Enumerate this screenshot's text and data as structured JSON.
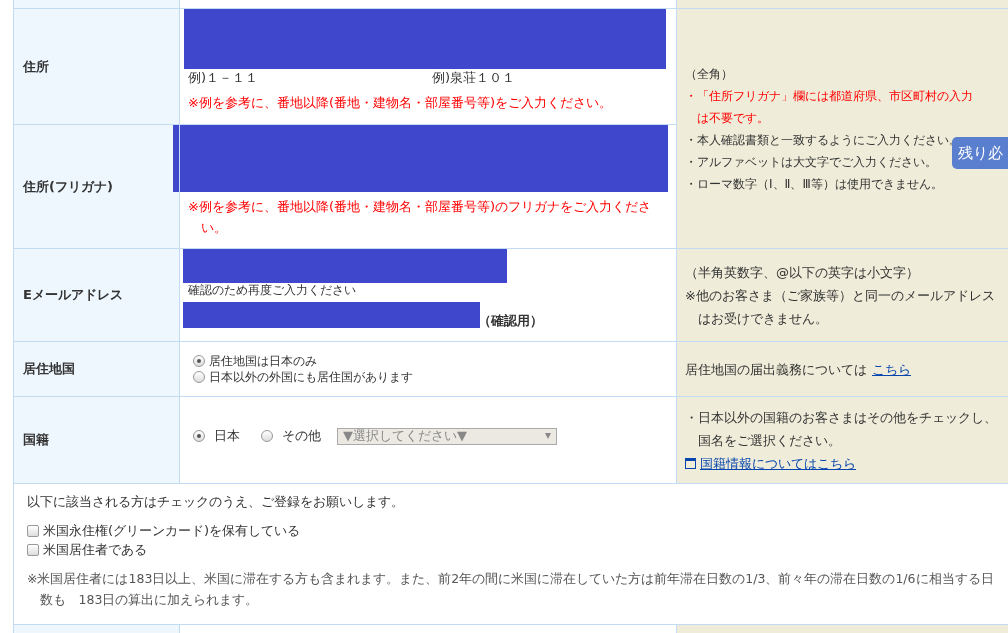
{
  "address": {
    "label": "住所",
    "examples": [
      "例)１－１１",
      "例)泉荘１０１"
    ],
    "warning": "※例を参考に、番地以降(番地・建物名・部屋番号等)をご入力ください。"
  },
  "address_kana": {
    "label": "住所(フリガナ)",
    "warning": "※例を参考に、番地以降(番地・建物名・部屋番号等)のフリガナをご入力ください。"
  },
  "address_notes": [
    {
      "text": "（全角）",
      "emphasis": false
    },
    {
      "text": "・「住所フリガナ」欄には都道府県、市区町村の入力は不要です。",
      "emphasis": true
    },
    {
      "text": "・本人確認書類と一致するようにご入力ください。",
      "emphasis": false
    },
    {
      "text": "・アルファベットは大文字でご入力ください。",
      "emphasis": false
    },
    {
      "text": "・ローマ数字（Ⅰ、Ⅱ、Ⅲ等）は使用できません。",
      "emphasis": false
    }
  ],
  "email": {
    "label": "Eメールアドレス",
    "reenter_hint": "確認のため再度ご入力ください",
    "confirm_suffix": "（確認用）",
    "notes": [
      "（半角英数字、@以下の英字は小文字）",
      "※他のお客さま（ご家族等）と同一のメールアドレスはお受けできません。"
    ]
  },
  "residence": {
    "label": "居住地国",
    "options": [
      {
        "label": "居住地国は日本のみ",
        "selected": true
      },
      {
        "label": "日本以外の外国にも居住国があります",
        "selected": false
      }
    ],
    "note": "居住地国の届出義務については",
    "link": "こちら"
  },
  "nationality": {
    "label": "国籍",
    "options": [
      {
        "label": "日本",
        "selected": true
      },
      {
        "label": "その他",
        "selected": false
      }
    ],
    "select": {
      "placeholder": "▼選択してください▼",
      "disabled": true
    },
    "note": "・日本以外の国籍のお客さまはその他をチェックし、国名をご選択ください。",
    "link": "国籍情報についてはこちら"
  },
  "us_section": {
    "intro": "以下に該当される方はチェックのうえ、ご登録をお願いします。",
    "checkboxes": [
      {
        "label": "米国永住権(グリーンカード)を保有している",
        "checked": false
      },
      {
        "label": "米国居住者である",
        "checked": false
      }
    ],
    "footnote": "※米国居住者には183日以上、米国に滞在する方も含まれます。また、前2年の間に米国に滞在していた方は前年滞在日数の1/3、前々年の滞在日数の1/6に相当する日数も　183日の算出に加えられます。"
  },
  "badge": "残り必"
}
